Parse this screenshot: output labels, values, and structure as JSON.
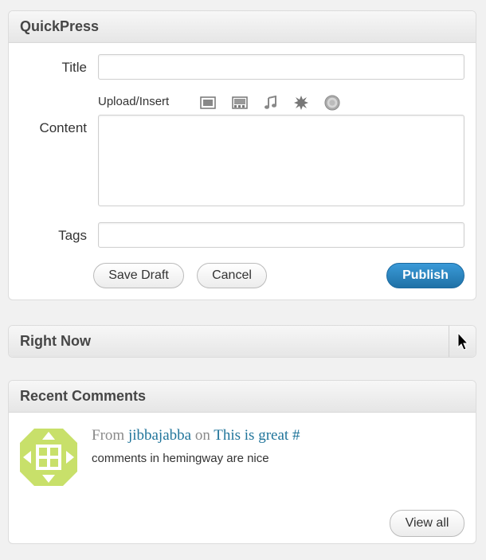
{
  "quickpress": {
    "title": "QuickPress",
    "title_label": "Title",
    "title_value": "",
    "upload_label": "Upload/Insert",
    "media_icons": [
      "image-icon",
      "video-icon",
      "audio-icon",
      "media-icon",
      "wordpress-icon"
    ],
    "content_label": "Content",
    "content_value": "",
    "tags_label": "Tags",
    "tags_value": "",
    "save_draft_label": "Save Draft",
    "cancel_label": "Cancel",
    "publish_label": "Publish"
  },
  "right_now": {
    "title": "Right Now"
  },
  "recent_comments": {
    "title": "Recent Comments",
    "comments": [
      {
        "from_word": "From",
        "author": "jibbajabba",
        "on_word": "on",
        "post": "This is great",
        "permalink": "#",
        "text": "comments in hemingway are nice"
      }
    ],
    "view_all_label": "View all"
  },
  "colors": {
    "accent": "#21759b",
    "publish": "#2a85c2",
    "avatar": "#c8e06a"
  }
}
